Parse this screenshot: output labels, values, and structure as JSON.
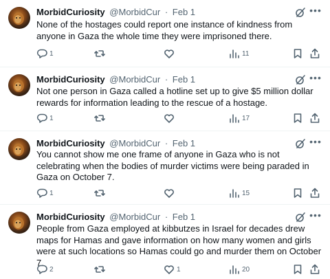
{
  "tweets": [
    {
      "display_name": "MorbidCuriosity",
      "handle": "@MorbidCur",
      "separator": "·",
      "date": "Feb 1",
      "text": "None of the hostages could report one instance of kindness from anyone in Gaza the whole time they were imprisoned there.",
      "replies": "1",
      "retweets": "",
      "likes": "",
      "views": "11"
    },
    {
      "display_name": "MorbidCuriosity",
      "handle": "@MorbidCur",
      "separator": "·",
      "date": "Feb 1",
      "text": "Not one person in Gaza called a hotline set up to give $5 million dollar rewards for information leading to the rescue of a hostage.",
      "replies": "1",
      "retweets": "",
      "likes": "",
      "views": "17"
    },
    {
      "display_name": "MorbidCuriosity",
      "handle": "@MorbidCur",
      "separator": "·",
      "date": "Feb 1",
      "text": "You cannot show me one frame of anyone in Gaza who is not celebrating when the bodies of murder victims were being paraded in Gaza on October 7.",
      "replies": "1",
      "retweets": "",
      "likes": "",
      "views": "15"
    },
    {
      "display_name": "MorbidCuriosity",
      "handle": "@MorbidCur",
      "separator": "·",
      "date": "Feb 1",
      "text": "People from Gaza employed at kibbutzes in Israel for decades drew maps for Hamas and gave information on how many women and girls were at such locations so Hamas could go and murder them on October 7.",
      "replies": "2",
      "retweets": "",
      "likes": "1",
      "views": "20"
    }
  ],
  "icons": {
    "reply": "reply-icon",
    "retweet": "retweet-icon",
    "like": "like-icon",
    "views": "views-icon",
    "bookmark": "bookmark-icon",
    "share": "share-icon",
    "grok": "grok-icon",
    "more": "more-icon"
  },
  "colors": {
    "text": "#0f1419",
    "secondary": "#536471",
    "divider": "#eff3f4"
  }
}
